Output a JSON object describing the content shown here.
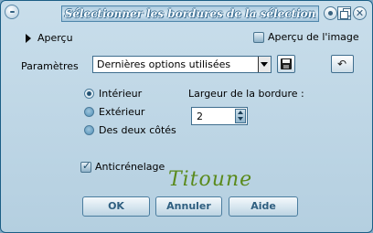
{
  "window": {
    "title": "Sélectionner les bordures de la sélection",
    "controls": {
      "help": "help-icon",
      "minimize": "minimize-icon",
      "close": "close-icon"
    }
  },
  "preview": {
    "toggle_label": "Aperçu",
    "image_preview_label": "Aperçu de l'image",
    "image_preview_checked": false
  },
  "settings": {
    "label": "Paramètres",
    "selected_value": "Dernières options utilisées",
    "save_icon": "floppy-disk-icon",
    "reset_icon": "reset-icon"
  },
  "position": {
    "options": [
      {
        "label": "Intérieur",
        "selected": true
      },
      {
        "label": "Extérieur",
        "selected": false
      },
      {
        "label": "Des deux côtés",
        "selected": false
      }
    ]
  },
  "border_width": {
    "label": "Largeur de la bordure :",
    "value": "2"
  },
  "antialias": {
    "label": "Anticrénelage",
    "checked": true
  },
  "watermark": {
    "text": "Titoune"
  },
  "buttons": {
    "ok": "OK",
    "cancel": "Annuler",
    "help": "Aide"
  },
  "colors": {
    "frame": "#1c5f86",
    "background": "#c0d8e7",
    "button_text": "#2f5f80",
    "watermark": "#5a8a1c"
  }
}
